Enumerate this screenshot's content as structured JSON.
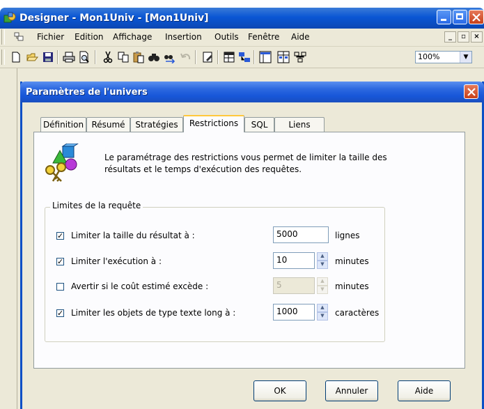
{
  "window": {
    "title": "Designer - Mon1Univ - [Mon1Univ]",
    "menu": [
      "Fichier",
      "Edition",
      "Affichage",
      "Insertion",
      "Outils",
      "Fenêtre",
      "Aide"
    ],
    "zoom": "100%"
  },
  "toolbar_icons": [
    "new-icon",
    "open-icon",
    "save-icon",
    "print-icon",
    "print-preview-icon",
    "cut-icon",
    "copy-icon",
    "paste-icon",
    "find-icon",
    "find-next-icon",
    "undo-icon",
    "format-icon",
    "table-browser-icon",
    "join-icon",
    "list-mode-icon",
    "arrange-icon",
    "refresh-icon"
  ],
  "dialog": {
    "title": "Paramètres de l'univers",
    "tabs": [
      "Définition",
      "Résumé",
      "Stratégies",
      "Restrictions",
      "SQL",
      "Liens"
    ],
    "active_tab": "Restrictions",
    "description_line1": "Le paramétrage des restrictions vous permet de limiter la taille des",
    "description_line2": "résultats et le temps d'exécution des requêtes.",
    "group_title": "Limites de la requête",
    "rows": [
      {
        "label": "Limiter la taille du résultat à :",
        "checked": true,
        "value": "5000",
        "unit": "lignes",
        "spinner": false,
        "enabled": true
      },
      {
        "label": "Limiter l'exécution à :",
        "checked": true,
        "value": "10",
        "unit": "minutes",
        "spinner": true,
        "enabled": true
      },
      {
        "label": "Avertir si le coût estimé excède :",
        "checked": false,
        "value": "5",
        "unit": "minutes",
        "spinner": true,
        "enabled": false
      },
      {
        "label": "Limiter les objets de type texte long à :",
        "checked": true,
        "value": "1000",
        "unit": "caractères",
        "spinner": true,
        "enabled": true
      }
    ],
    "buttons": {
      "ok": "OK",
      "cancel": "Annuler",
      "help": "Aide"
    }
  },
  "colors": {
    "xp_blue": "#0a56d4",
    "dialog_face": "#ece9d8",
    "tab_highlight": "#ffc83c"
  }
}
